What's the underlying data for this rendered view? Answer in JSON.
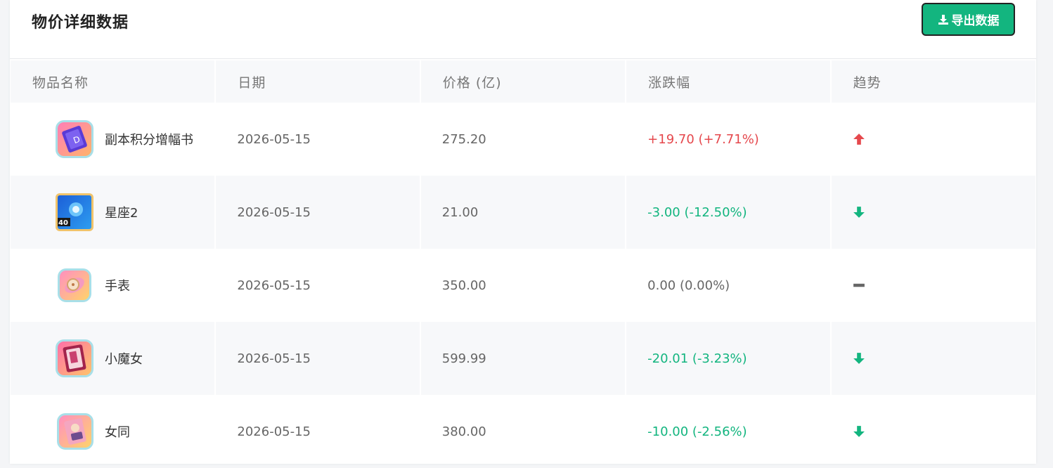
{
  "header": {
    "title": "物价详细数据",
    "export_label": "导出数据"
  },
  "table": {
    "columns": [
      "物品名称",
      "日期",
      "价格 (亿)",
      "涨跌幅",
      "趋势"
    ],
    "rows": [
      {
        "name": "副本积分增幅书",
        "date": "2026-05-15",
        "price": "275.20",
        "change": "+19.70 (+7.71%)",
        "trend": "up",
        "icon": "book-icon"
      },
      {
        "name": "星座2",
        "date": "2026-05-15",
        "price": "21.00",
        "change": "-3.00 (-12.50%)",
        "trend": "down",
        "icon": "card-icon"
      },
      {
        "name": "手表",
        "date": "2026-05-15",
        "price": "350.00",
        "change": "0.00 (0.00%)",
        "trend": "flat",
        "icon": "watch-icon"
      },
      {
        "name": "小魔女",
        "date": "2026-05-15",
        "price": "599.99",
        "change": "-20.01 (-3.23%)",
        "trend": "down",
        "icon": "witch-card-icon"
      },
      {
        "name": "女同",
        "date": "2026-05-15",
        "price": "380.00",
        "change": "-10.00 (-2.56%)",
        "trend": "down",
        "icon": "portrait-card-icon"
      }
    ]
  },
  "colors": {
    "up": "#e5484d",
    "down": "#13b57f",
    "flat": "#666666",
    "accent": "#13b57f"
  }
}
